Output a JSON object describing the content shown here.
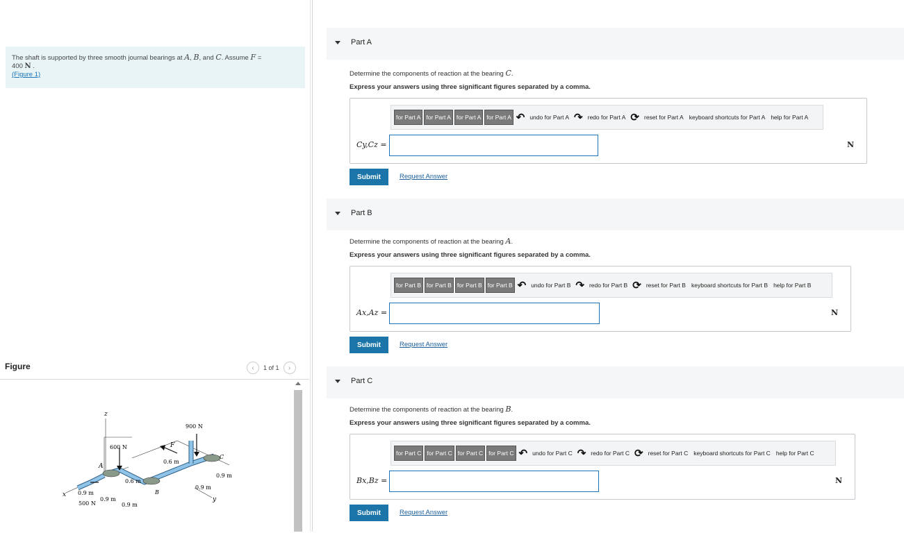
{
  "problem": {
    "text_1": "The shaft is supported by three smooth journal bearings at ",
    "A": "A",
    "B": "B",
    "C": "C",
    "text_2": ". Assume ",
    "F": "F",
    "text_3": " =",
    "force_value": "400",
    "force_unit": "N",
    "figure_link": "(Figure 1)"
  },
  "figure_panel": {
    "title": "Figure",
    "pager_text": "1 of 1",
    "labels": {
      "z": "z",
      "x": "x",
      "y": "y",
      "A": "A",
      "B": "B",
      "C": "C",
      "F": "F",
      "load_600": "600 N",
      "load_900": "900 N",
      "load_500": "500 N",
      "d_06_a": "0.6 m",
      "d_06_b": "0.6 m",
      "d_09_a": "0.9 m",
      "d_09_b": "0.9 m",
      "d_09_c": "0.9 m",
      "d_09_d": "0.9 m",
      "d_09_e": "0.9 m"
    }
  },
  "parts": [
    {
      "label": "Part A",
      "prompt_pre": "Determine the components of reaction at the bearing ",
      "bearing": "C",
      "prompt_post": ".",
      "instruction": "Express your answers using three significant figures separated by a comma.",
      "toolbar": {
        "btn1": "for Part A",
        "btn2": "for Part A",
        "btn3": "for Part A",
        "btn4": "for Part A",
        "undo": "undo for Part A",
        "redo": "redo for Part A",
        "reset": "reset for Part A",
        "keyboard": "keyboard shortcuts for Part A",
        "help": "help for Part A"
      },
      "variable": "Cy,Cz =",
      "input_value": "",
      "unit": "N",
      "submit": "Submit",
      "request": "Request Answer"
    },
    {
      "label": "Part B",
      "prompt_pre": "Determine the components of reaction at the bearing ",
      "bearing": "A",
      "prompt_post": ".",
      "instruction": "Express your answers using three significant figures separated by a comma.",
      "toolbar": {
        "btn1": "for Part B",
        "btn2": "for Part B",
        "btn3": "for Part B",
        "btn4": "for Part B",
        "undo": "undo for Part B",
        "redo": "redo for Part B",
        "reset": "reset for Part B",
        "keyboard": "keyboard shortcuts for Part B",
        "help": "help for Part B"
      },
      "variable": "Ax,Az =",
      "input_value": "",
      "unit": "N",
      "submit": "Submit",
      "request": "Request Answer"
    },
    {
      "label": "Part C",
      "prompt_pre": "Determine the components of reaction at the bearing ",
      "bearing": "B",
      "prompt_post": ".",
      "instruction": "Express your answers using three significant figures separated by a comma.",
      "toolbar": {
        "btn1": "for Part C",
        "btn2": "for Part C",
        "btn3": "for Part C",
        "btn4": "for Part C",
        "undo": "undo for Part C",
        "redo": "redo for Part C",
        "reset": "reset for Part C",
        "keyboard": "keyboard shortcuts for Part C",
        "help": "help for Part C"
      },
      "variable": "Bx,Bz =",
      "input_value": "",
      "unit": "N",
      "submit": "Submit",
      "request": "Request Answer"
    }
  ],
  "colors": {
    "accent": "#1b75a8",
    "problem_bg": "#e8f4f6",
    "part_header_bg": "#f5f6f7",
    "link": "#1a5f9c",
    "shaft": "#8fc4e8"
  },
  "icons": {
    "collapse": "caret-down-icon",
    "prev": "chevron-left-icon",
    "next": "chevron-right-icon",
    "scroll_up": "scroll-up-icon"
  }
}
